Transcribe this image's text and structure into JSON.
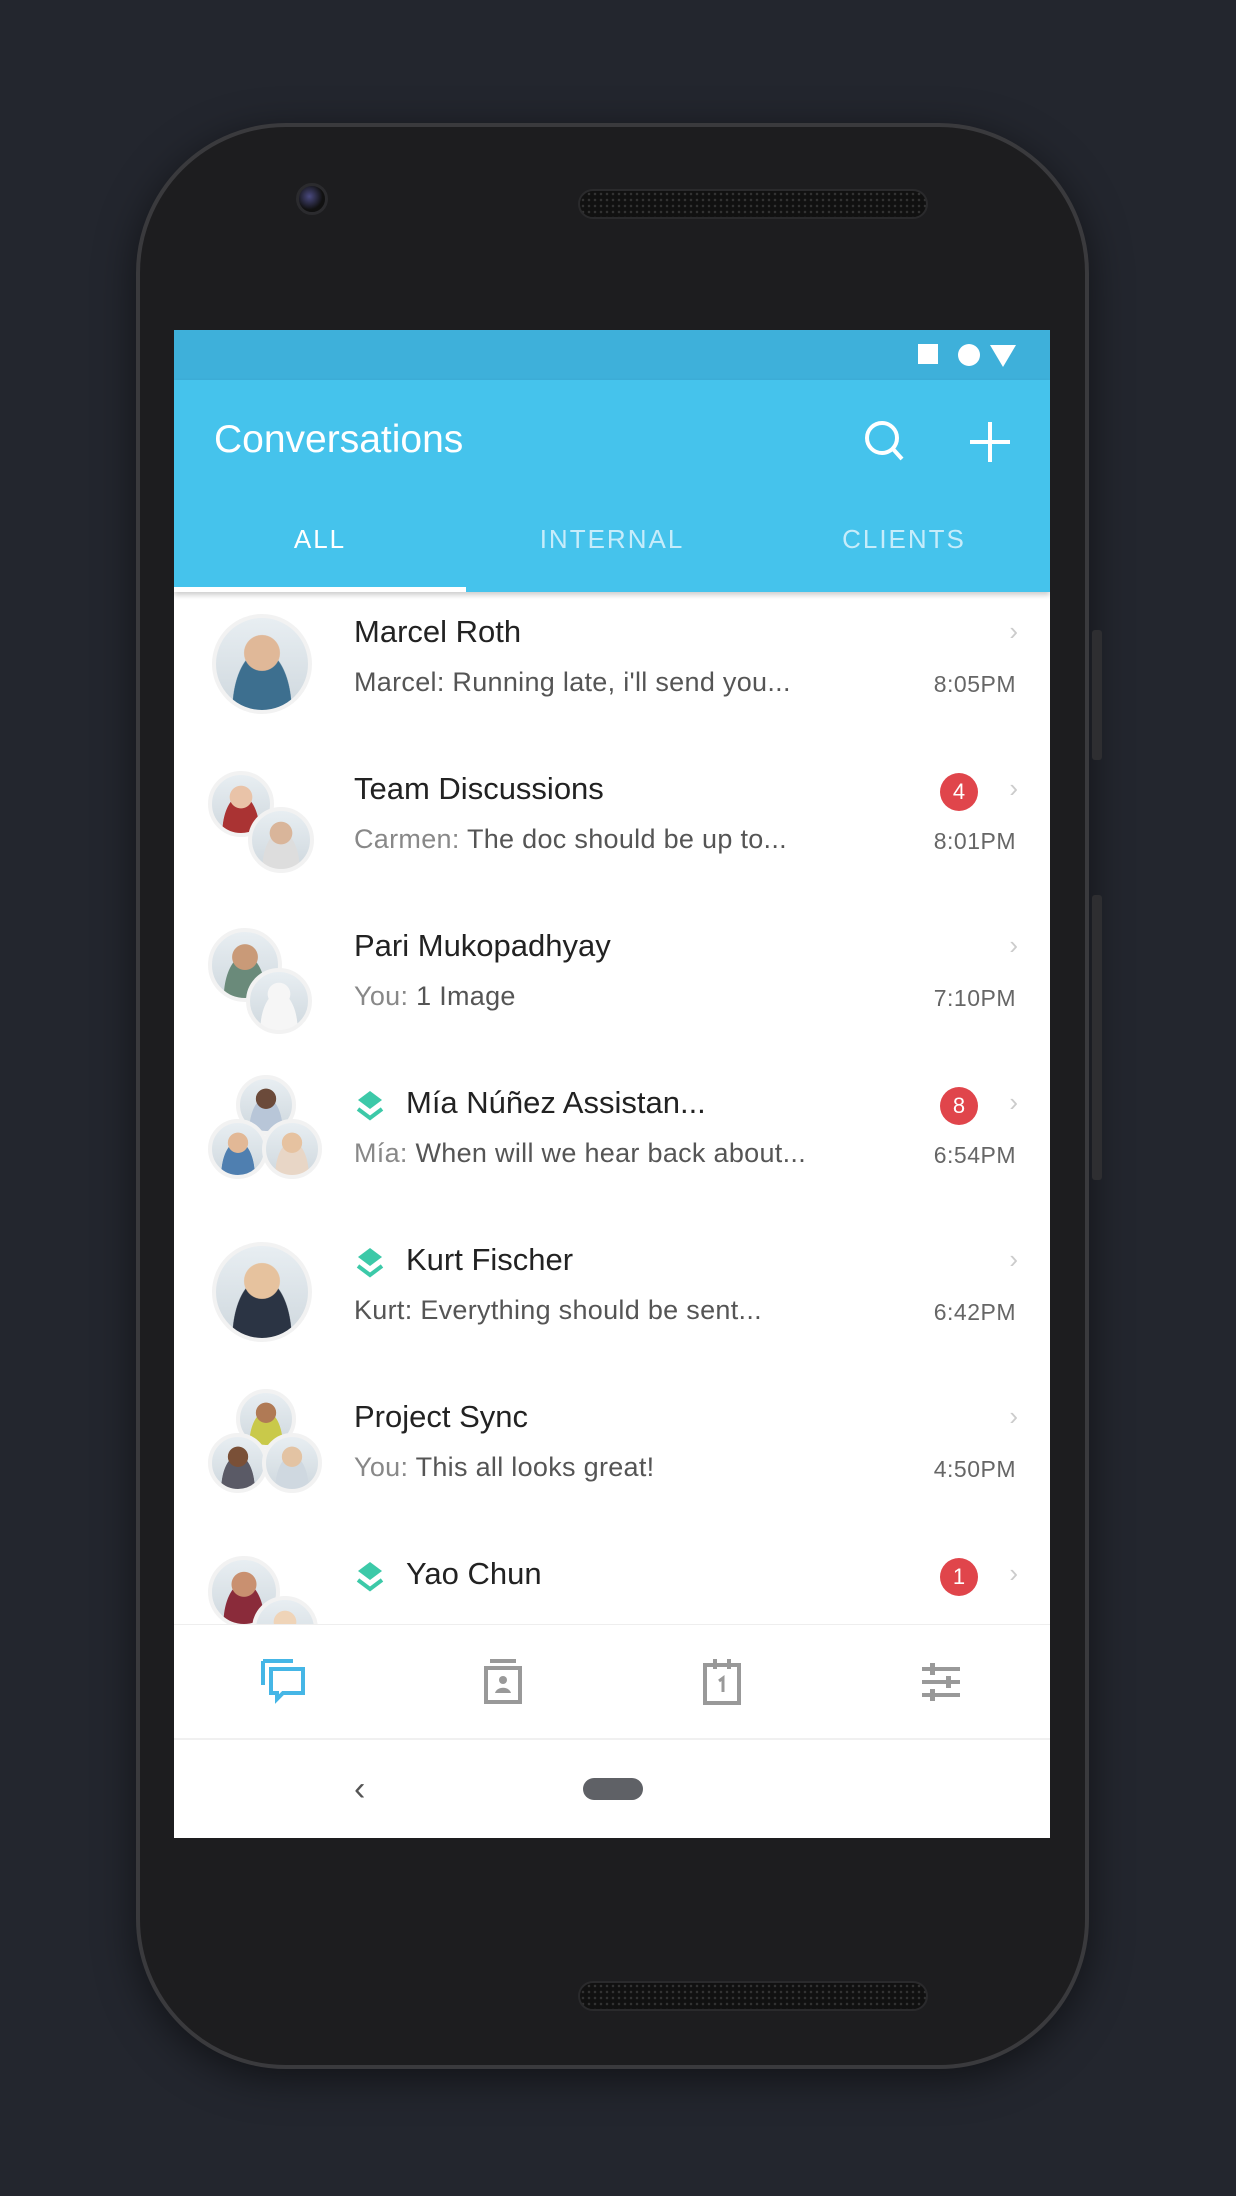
{
  "app": {
    "title": "Conversations",
    "search_icon": "search-icon",
    "add_icon": "plus-icon"
  },
  "status_bar": {
    "icons": [
      "square-icon",
      "circle-icon",
      "triangle-icon"
    ]
  },
  "tabs": [
    {
      "label": "ALL",
      "active": true
    },
    {
      "label": "INTERNAL",
      "active": false
    },
    {
      "label": "CLIENTS",
      "active": false
    }
  ],
  "colors": {
    "primary": "#45c3ec",
    "status_bar": "#3eb0da",
    "badge": "#e0454b",
    "tag": "#3cc9a8",
    "active_nav": "#45b6e6"
  },
  "conversations": [
    {
      "name": "Marcel Roth",
      "sender": "",
      "preview": "Marcel: Running late, i'll send you...",
      "time": "8:05PM",
      "badge": null,
      "tagged": false
    },
    {
      "name": "Team Discussions",
      "sender": "Carmen: ",
      "preview": "The doc should be up to...",
      "time": "8:01PM",
      "badge": "4",
      "tagged": false
    },
    {
      "name": "Pari Mukopadhyay",
      "sender": "You: ",
      "preview": "1 Image",
      "time": "7:10PM",
      "badge": null,
      "tagged": false
    },
    {
      "name": "Mía Núñez Assistan...",
      "sender": "Mía: ",
      "preview": "When will we hear back about...",
      "time": "6:54PM",
      "badge": "8",
      "tagged": true
    },
    {
      "name": "Kurt Fischer",
      "sender": "",
      "preview": "Kurt: Everything should be sent...",
      "time": "6:42PM",
      "badge": null,
      "tagged": true
    },
    {
      "name": "Project Sync",
      "sender": "You: ",
      "preview": "This all looks great!",
      "time": "4:50PM",
      "badge": null,
      "tagged": false
    },
    {
      "name": "Yao Chun",
      "sender": "",
      "preview": "",
      "time": "",
      "badge": "1",
      "tagged": true
    }
  ],
  "bottom_nav": [
    {
      "icon": "chat-icon",
      "active": true
    },
    {
      "icon": "contacts-icon",
      "active": false
    },
    {
      "icon": "calendar-icon",
      "active": false
    },
    {
      "icon": "sliders-icon",
      "active": false
    }
  ]
}
